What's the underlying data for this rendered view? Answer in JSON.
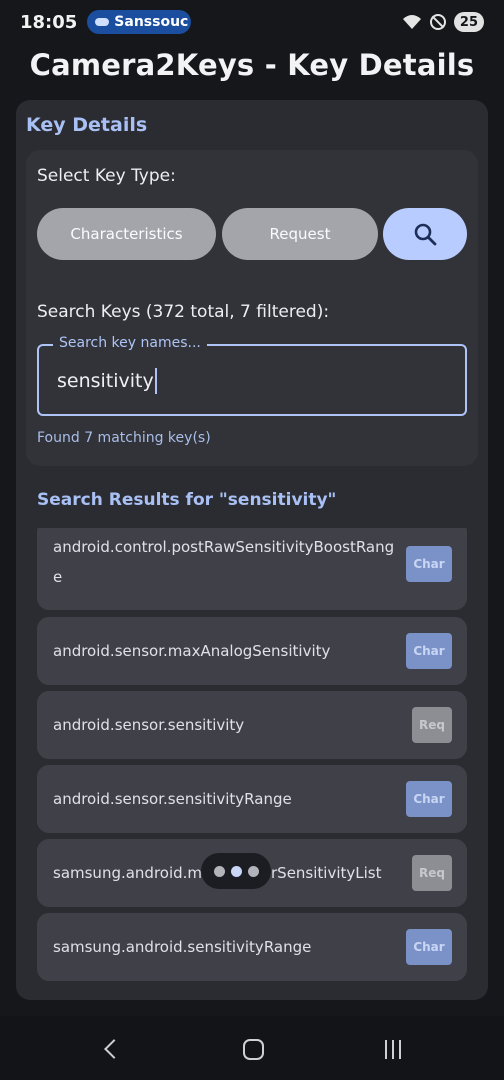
{
  "status_bar": {
    "time": "18:05",
    "notification_pill": "Sanssouc",
    "battery": "25",
    "icons": [
      "wifi-icon",
      "do-not-disturb-icon"
    ]
  },
  "app": {
    "title": "Camera2Keys - Key Details"
  },
  "key_details": {
    "heading": "Key Details",
    "select_label": "Select Key Type:",
    "buttons": {
      "characteristics": "Characteristics",
      "request": "Request",
      "search_icon": "search-icon"
    }
  },
  "search": {
    "label": "Search Keys (372 total, 7 filtered):",
    "placeholder": "Search key names...",
    "value": "sensitivity",
    "found_text": "Found 7 matching key(s)"
  },
  "results": {
    "heading": "Search Results for \"sensitivity\"",
    "items": [
      {
        "name": "android.control.postRawSensitivityBoostRange",
        "badge": "Char"
      },
      {
        "name": "android.sensor.maxAnalogSensitivity",
        "badge": "Char"
      },
      {
        "name": "android.sensor.sensitivity",
        "badge": "Req"
      },
      {
        "name": "android.sensor.sensitivityRange",
        "badge": "Char"
      },
      {
        "name": "samsung.android.multiSensorSensitivityList",
        "badge": "Req"
      },
      {
        "name": "samsung.android.sensitivityRange",
        "badge": "Char"
      }
    ]
  },
  "colors": {
    "accent": "#a9c0f5",
    "search_button": "#b8ccff",
    "char_badge": "#7a92c8",
    "req_badge": "#8d8e94"
  }
}
